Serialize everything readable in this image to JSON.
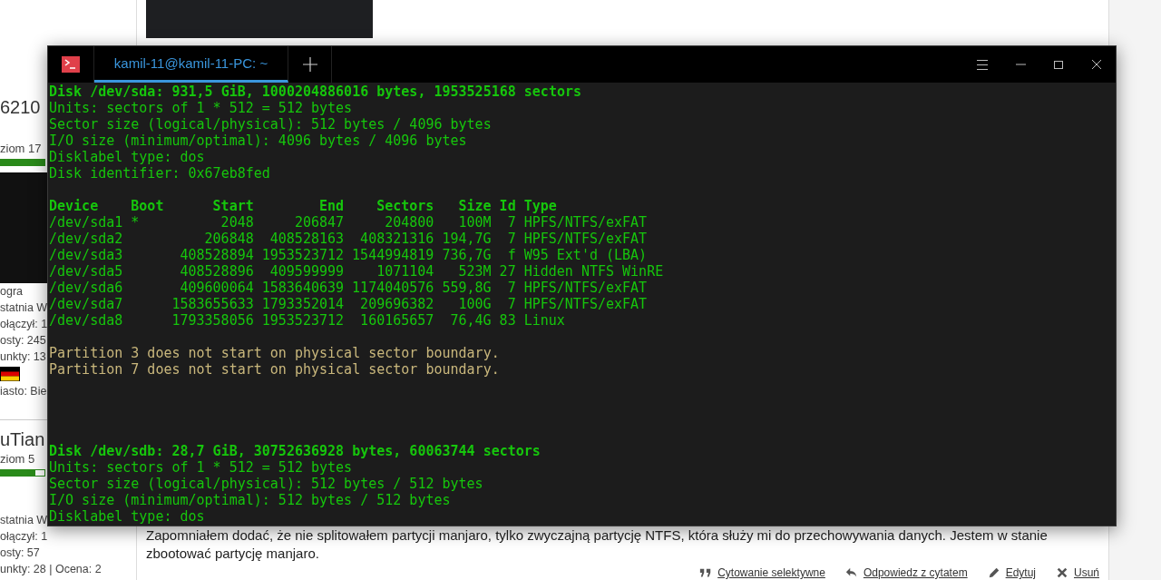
{
  "forum": {
    "users": [
      {
        "author": "6210",
        "rank": "ziom 17",
        "level": 1,
        "flag": true,
        "details": [
          "ogra",
          "statnia W",
          "ołączył: 1",
          "osty: 245",
          "unkty: 13"
        ],
        "city": "iasto: Bie"
      },
      {
        "author": "uTian",
        "rank": "ziom 5",
        "level": 0.8,
        "details": [
          "statnia W",
          "ołączył: 1",
          "osty: 57",
          "unkty: 28 | Ocena: 2"
        ]
      }
    ],
    "post_text": "Zapomniałem dodać, że nie splitowałem partycji manjaro, tylko zwyczajną partycję NTFS, która służy mi do przechowywania danych. Jestem w stanie zbootować partycję manjaro.",
    "actions": [
      {
        "kind": "quote",
        "label": "Cytowanie selektywne"
      },
      {
        "kind": "reply",
        "label": "Odpowiedz z cytatem"
      },
      {
        "kind": "edit",
        "label": "Edytuj"
      },
      {
        "kind": "delete",
        "label": "Usuń"
      }
    ]
  },
  "terminal": {
    "tabs": [
      {
        "title": "kamil-11@kamil-11-PC: ~",
        "selected": true
      }
    ],
    "lines": [
      {
        "kind": "bold",
        "text": "Disk /dev/sda: 931,5 GiB, 1000204886016 bytes, 1953525168 sectors"
      },
      {
        "kind": "text",
        "text": "Units: sectors of 1 * 512 = 512 bytes"
      },
      {
        "kind": "text",
        "text": "Sector size (logical/physical): 512 bytes / 4096 bytes"
      },
      {
        "kind": "text",
        "text": "I/O size (minimum/optimal): 4096 bytes / 4096 bytes"
      },
      {
        "kind": "text",
        "text": "Disklabel type: dos"
      },
      {
        "kind": "text",
        "text": "Disk identifier: 0x67eb8fed"
      },
      {
        "kind": "blank"
      },
      {
        "kind": "table",
        "columns": [
          "Device",
          "Boot",
          "Start",
          "End",
          "Sectors",
          "Size",
          "Id",
          "Type"
        ],
        "rows": [
          [
            "/dev/sda1",
            "*",
            "2048",
            "206847",
            "204800",
            "100M",
            "7",
            "HPFS/NTFS/exFAT"
          ],
          [
            "/dev/sda2",
            null,
            "206848",
            "408528163",
            "408321316",
            "194,7G",
            "7",
            "HPFS/NTFS/exFAT"
          ],
          [
            "/dev/sda3",
            null,
            "408528894",
            "1953523712",
            "1544994819",
            "736,7G",
            "f",
            "W95 Ext'd (LBA)"
          ],
          [
            "/dev/sda5",
            null,
            "408528896",
            "409599999",
            "1071104",
            "523M",
            "27",
            "Hidden NTFS WinRE"
          ],
          [
            "/dev/sda6",
            null,
            "409600064",
            "1583640639",
            "1174040576",
            "559,8G",
            "7",
            "HPFS/NTFS/exFAT"
          ],
          [
            "/dev/sda7",
            null,
            "1583655633",
            "1793352014",
            "209696382",
            "100G",
            "7",
            "HPFS/NTFS/exFAT"
          ],
          [
            "/dev/sda8",
            null,
            "1793358056",
            "1953523712",
            "160165657",
            "76,4G",
            "83",
            "Linux"
          ]
        ]
      },
      {
        "kind": "blank"
      },
      {
        "kind": "warn",
        "text": "Partition 3 does not start on physical sector boundary."
      },
      {
        "kind": "warn",
        "text": "Partition 7 does not start on physical sector boundary."
      },
      {
        "kind": "blank"
      },
      {
        "kind": "blank"
      },
      {
        "kind": "blank"
      },
      {
        "kind": "blank"
      },
      {
        "kind": "bold",
        "text": "Disk /dev/sdb: 28,7 GiB, 30752636928 bytes, 60063744 sectors"
      },
      {
        "kind": "text",
        "text": "Units: sectors of 1 * 512 = 512 bytes"
      },
      {
        "kind": "text",
        "text": "Sector size (logical/physical): 512 bytes / 512 bytes"
      },
      {
        "kind": "text",
        "text": "I/O size (minimum/optimal): 512 bytes / 512 bytes"
      },
      {
        "kind": "text",
        "text": "Disklabel type: dos"
      }
    ]
  }
}
